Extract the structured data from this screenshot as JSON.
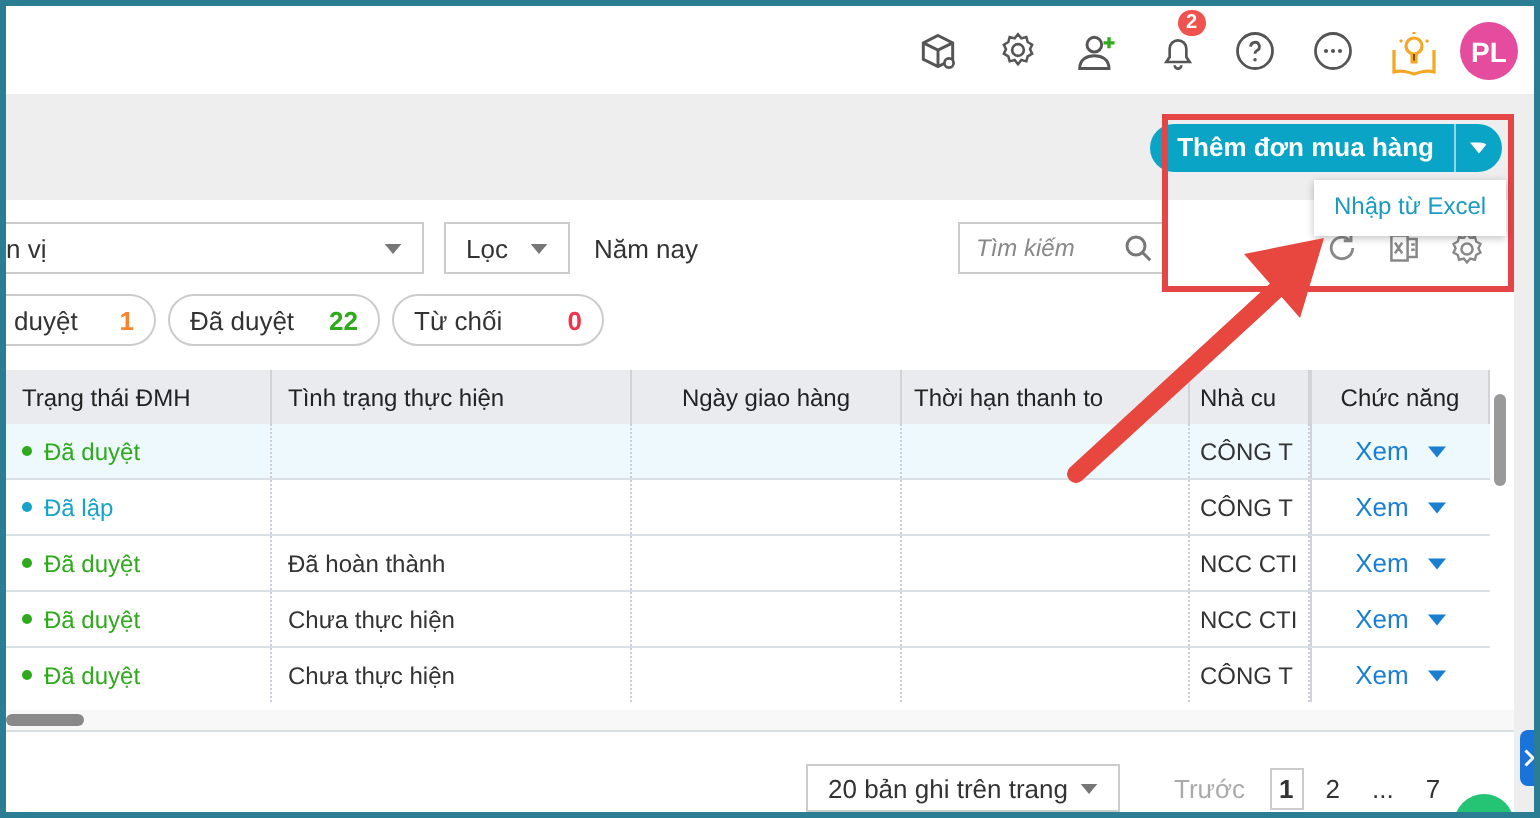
{
  "toolbar": {
    "notification_count": "2",
    "avatar_initials": "PL"
  },
  "add_button": {
    "label": "Thêm đơn mua hàng"
  },
  "dropdown_menu": [
    {
      "label": "Nhập từ Excel"
    }
  ],
  "filters": {
    "unit_value": "n vị",
    "filter_label": "Lọc",
    "period": "Năm nay",
    "search_placeholder": "Tìm kiếm"
  },
  "status_tabs": [
    {
      "label": "duyệt",
      "count": "1",
      "color": "#f5862f"
    },
    {
      "label": "Đã duyệt",
      "count": "22",
      "color": "#2eaa1c"
    },
    {
      "label": "Từ chối",
      "count": "0",
      "color": "#f0324a"
    }
  ],
  "table": {
    "columns": [
      "Trạng thái ĐMH",
      "Tình trạng thực hiện",
      "Ngày giao hàng",
      "Thời hạn thanh to",
      "Nhà cu",
      "Chức năng"
    ],
    "rows": [
      {
        "status": "Đã duyệt",
        "color": "#2eaa1c",
        "progress": "",
        "supplier": "CÔNG T",
        "action": "Xem",
        "highlighted": true
      },
      {
        "status": "Đã lập",
        "color": "#17a2c8",
        "progress": "",
        "supplier": "CÔNG T",
        "action": "Xem",
        "highlighted": false
      },
      {
        "status": "Đã duyệt",
        "color": "#2eaa1c",
        "progress": "Đã hoàn thành",
        "supplier": "NCC CTI",
        "action": "Xem",
        "highlighted": false
      },
      {
        "status": "Đã duyệt",
        "color": "#2eaa1c",
        "progress": "Chưa thực hiện",
        "supplier": "NCC CTI",
        "action": "Xem",
        "highlighted": false
      },
      {
        "status": "Đã duyệt",
        "color": "#2eaa1c",
        "progress": "Chưa thực hiện",
        "supplier": "CÔNG T",
        "action": "Xem",
        "highlighted": false
      }
    ]
  },
  "pagination": {
    "page_size": "20 bản ghi trên trang",
    "prev": "Trước",
    "pages": [
      {
        "label": "1",
        "selected": true
      },
      {
        "label": "2",
        "selected": false
      },
      {
        "label": "...",
        "selected": false
      },
      {
        "label": "7",
        "selected": false
      }
    ]
  }
}
